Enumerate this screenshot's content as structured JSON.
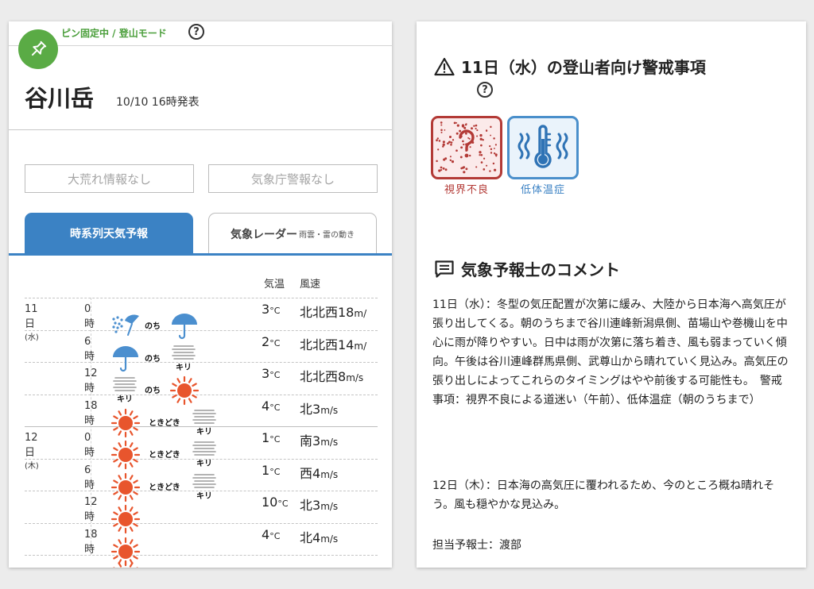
{
  "left_panel": {
    "pin_mode_label": "ピン固定中 / 登山モード",
    "pin_help_glyph": "?",
    "mountain_name": "谷川岳",
    "issued": "10/10 16時発表",
    "storm_info": "大荒れ情報なし",
    "jma_warning": "気象庁警報なし",
    "tabs": {
      "series_label": "時系列天気予報",
      "radar_label": "気象レーダー",
      "radar_sub": "雨雲・雷の動き"
    },
    "columns": {
      "temp": "気温",
      "wind": "風速"
    },
    "unit_temp": "°C",
    "unit_wind": "m/s",
    "rows": [
      {
        "date": "11日",
        "weekday": "(水)",
        "time": "0時",
        "icon1": "snow-rain-icon",
        "connector": "のち",
        "icon2": "umbrella-icon",
        "temp": "3",
        "wind": "北北西18",
        "wind_unit": "m/"
      },
      {
        "date": "",
        "weekday": "",
        "time": "6時",
        "icon1": "umbrella-icon",
        "connector": "のち",
        "icon2": "fog-icon",
        "icon2_label": "キリ",
        "temp": "2",
        "wind": "北北西14",
        "wind_unit": "m/"
      },
      {
        "date": "",
        "weekday": "",
        "time": "12時",
        "icon1": "fog-icon",
        "icon1_label": "キリ",
        "connector": "のち",
        "icon2": "sun-icon",
        "temp": "3",
        "wind": "北北西8",
        "wind_unit": "m/s"
      },
      {
        "date": "",
        "weekday": "",
        "time": "18時",
        "icon1": "sun-icon",
        "connector": "ときどき",
        "icon2": "fog-icon",
        "icon2_label": "キリ",
        "temp": "4",
        "wind": "北3",
        "wind_unit": "m/s"
      },
      {
        "date": "12日",
        "weekday": "(木)",
        "time": "0時",
        "icon1": "sun-icon",
        "connector": "ときどき",
        "icon2": "fog-icon",
        "icon2_label": "キリ",
        "temp": "1",
        "wind": "南3",
        "wind_unit": "m/s"
      },
      {
        "date": "",
        "weekday": "",
        "time": "6時",
        "icon1": "sun-icon",
        "connector": "ときどき",
        "icon2": "fog-icon",
        "icon2_label": "キリ",
        "temp": "1",
        "wind": "西4",
        "wind_unit": "m/s"
      },
      {
        "date": "",
        "weekday": "",
        "time": "12時",
        "icon1": "sun-icon",
        "connector": "",
        "icon2": "",
        "temp": "10",
        "wind": "北3",
        "wind_unit": "m/s"
      },
      {
        "date": "",
        "weekday": "",
        "time": "18時",
        "icon1": "sun-icon",
        "connector": "",
        "icon2": "",
        "temp": "4",
        "wind": "北4",
        "wind_unit": "m/s"
      }
    ],
    "extra_icon": "sun-icon"
  },
  "right_panel": {
    "warning_title": "11日（水）の登山者向け警戒事項",
    "warning_help_glyph": "?",
    "hazards": [
      {
        "label": "視界不良",
        "icon": "poor-visibility-icon",
        "color": "#b33a36"
      },
      {
        "label": "低体温症",
        "icon": "hypothermia-icon",
        "color": "#3b82c4"
      }
    ],
    "comment_title": "気象予報士のコメント",
    "comment_p1": "11日（水）：冬型の気圧配置が次第に緩み、大陸から日本海へ高気圧が張り出してくる。朝のうちまで谷川連峰新潟県側、苗場山や巻機山を中心に雨が降りやすい。日中は雨が次第に落ち着き、風も弱まっていく傾向。午後は谷川連峰群馬県側、武尊山から晴れていく見込み。高気圧の張り出しによってこれらのタイミングはやや前後する可能性も。　警戒事項：視界不良による道迷い（午前）、低体温症（朝のうちまで）",
    "comment_p2": "12日（木）：日本海の高気圧に覆われるため、今のところ概ね晴れそう。風も穏やかな見込み。",
    "forecaster": "担当予報士：渡部"
  },
  "colors": {
    "accent_blue": "#3b82c4",
    "pin_green": "#5aab45",
    "sun_orange": "#e8552d",
    "visibility_red": "#b33a36"
  }
}
